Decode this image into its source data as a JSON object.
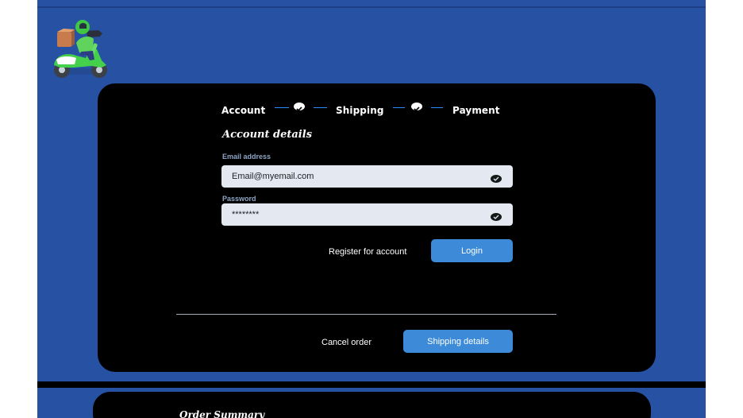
{
  "brand": {
    "logo_name": "delivery-scooter-logo"
  },
  "stepper": {
    "steps": [
      {
        "label": "Account",
        "state": "completed"
      },
      {
        "label": "Shipping",
        "state": "completed"
      },
      {
        "label": "Payment",
        "state": "current"
      }
    ]
  },
  "account": {
    "title": "Account details",
    "email": {
      "label": "Email address",
      "value": "Email@myemail.com"
    },
    "password": {
      "label": "Password",
      "value": "********"
    },
    "register_label": "Register for account",
    "login_label": "Login"
  },
  "footer": {
    "cancel_label": "Cancel order",
    "shipping_label": "Shipping details"
  },
  "summary": {
    "title": "Order Summary"
  },
  "colors": {
    "background": "#2751a3",
    "card": "#000000",
    "accent": "#3c8ad8",
    "input": "#e4e9f1",
    "step_line": "#2c8cff"
  },
  "icons": {
    "logo": "scooter-rider-icon",
    "step_check": "check-icon",
    "field_toggle": "eye-icon"
  }
}
